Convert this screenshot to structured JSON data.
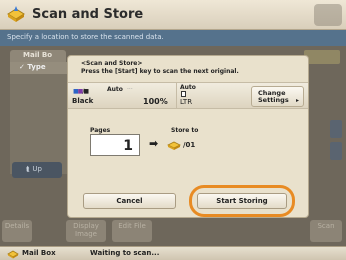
{
  "header": {
    "title": "Scan and Store",
    "instruction": "Specify a location to store the scanned data."
  },
  "background": {
    "mailbox_tab": "Mail Bo",
    "list_header": "Type",
    "up_label": "Up",
    "bottom_buttons": [
      "Details",
      "Display Image",
      "Edit File",
      "Scan"
    ]
  },
  "modal": {
    "message_line1": "<Scan and Store>",
    "message_line2": "Press the [Start] key to scan the next original.",
    "settings": {
      "color_mode_auto": "Auto",
      "color_mode": "Black",
      "zoom": "100%",
      "paper_auto": "Auto",
      "paper_size": "LTR",
      "change_settings_line1": "Change",
      "change_settings_line2": "Settings"
    },
    "pages_label": "Pages",
    "pages_value": "1",
    "store_to_label": "Store to",
    "store_to_value": "/01",
    "cancel_label": "Cancel",
    "start_storing_label": "Start Storing"
  },
  "status": {
    "mailbox_label": "Mail Box",
    "state": "Waiting to scan..."
  },
  "colors": {
    "highlight": "#e88b23",
    "instruction_bg": "#55728c"
  }
}
